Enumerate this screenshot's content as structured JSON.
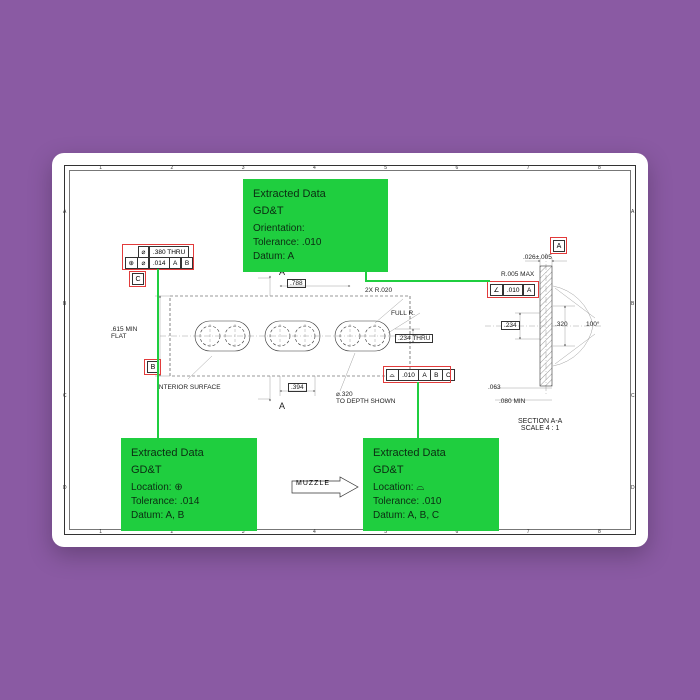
{
  "ruler": {
    "numbers": [
      "1",
      "2",
      "3",
      "4",
      "5",
      "6",
      "7",
      "8"
    ],
    "letters": [
      "A",
      "B",
      "C",
      "D"
    ]
  },
  "callouts": {
    "top": {
      "title": "Extracted Data",
      "cat": "GD&T",
      "l1": "Orientation:",
      "l2": "Tolerance: .010",
      "l3": "Datum: A"
    },
    "left": {
      "title": "Extracted Data",
      "cat": "GD&T",
      "l1": "Location: ⊕",
      "l2": "Tolerance: .014",
      "l3": "Datum: A, B"
    },
    "right": {
      "title": "Extracted Data",
      "cat": "GD&T",
      "l1": "Location: ⌓",
      "l2": "Tolerance: .010",
      "l3": "Datum: A, B, C"
    }
  },
  "fcf": {
    "topleft_dia": {
      "sym": "⌀",
      "val": ".380 THRU"
    },
    "topleft_pos": {
      "sym": "⊕",
      "val": ".014",
      "d1": "A",
      "d2": "B"
    },
    "bottom_prof": {
      "sym": "⌓",
      "val": ".010",
      "d1": "A",
      "d2": "B",
      "d3": "C"
    },
    "sec_ang": {
      "sym": "∠",
      "val": ".010",
      "d1": "A"
    }
  },
  "datum": {
    "A": "A",
    "B": "B",
    "C": "C"
  },
  "dims": {
    "d788": ".788",
    "r020": "2X  R.020",
    "fullr": "FULL R.",
    "d234thru": ".234  THRU",
    "d394": ".394",
    "d320depth_a": "⌀.320",
    "d320depth_b": "TO DEPTH SHOWN",
    "min615": ".615 MIN\nFLAT",
    "intsurf": "INTERIOR SURFACE",
    "sectA1": "A",
    "sectA2": "A",
    "tol026": ".026±.005",
    "r005": "R.005 MAX",
    "d234": ".234",
    "d320": ".320",
    "ang100": "100°",
    "d063": ".063",
    "min080": ".080 MIN",
    "sectionlbl_a": "SECTION A-A",
    "sectionlbl_b": "SCALE 4 : 1"
  },
  "misc": {
    "muzzle": "MUZZLE"
  }
}
